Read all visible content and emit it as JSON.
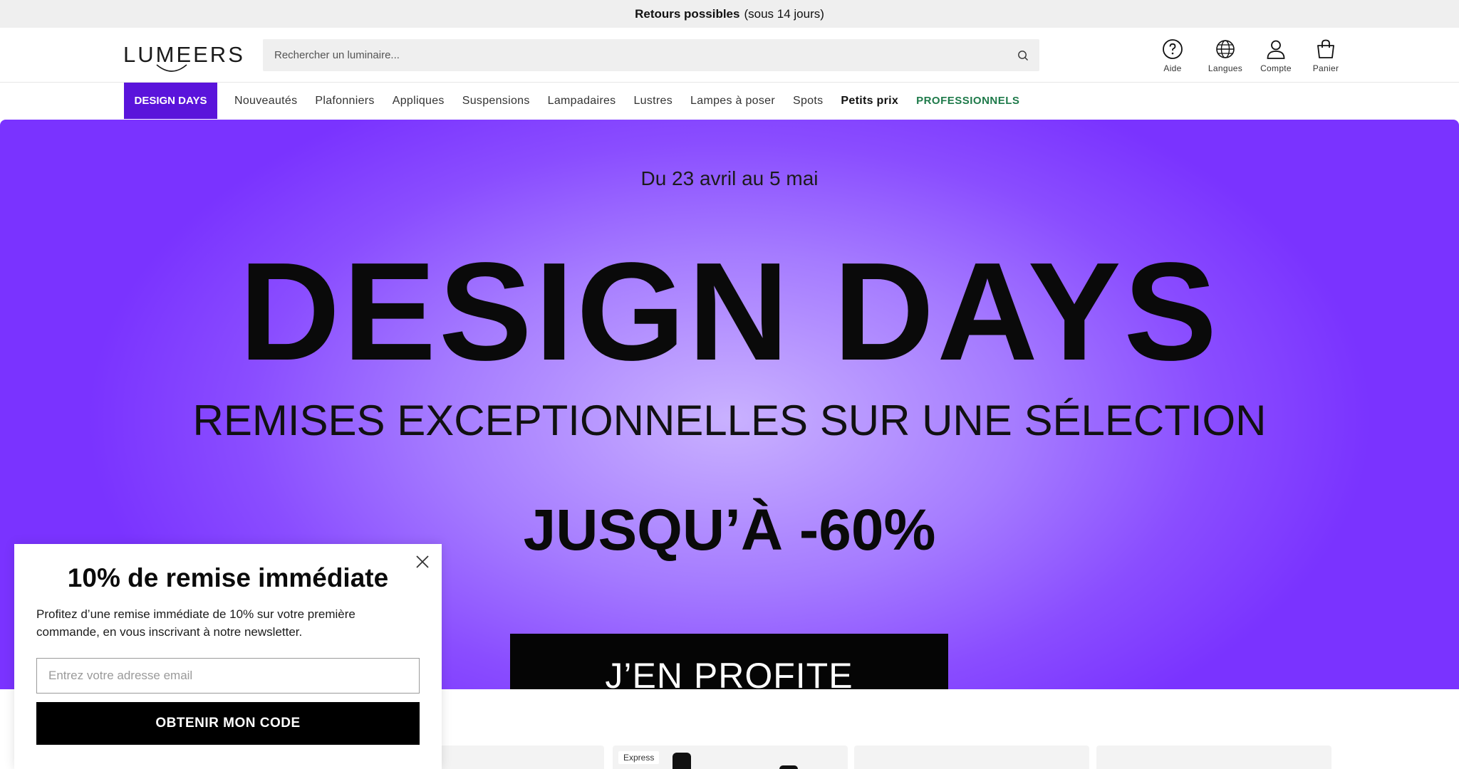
{
  "announcement": {
    "bold": "Retours possibles",
    "rest": "(sous 14 jours)"
  },
  "header": {
    "logo_text": "LUMEERS",
    "search_placeholder": "Rechercher un luminaire...",
    "icons": [
      {
        "label": "Aide",
        "icon": "help-circle-icon"
      },
      {
        "label": "Langues",
        "icon": "globe-icon"
      },
      {
        "label": "Compte",
        "icon": "user-icon"
      },
      {
        "label": "Panier",
        "icon": "shopping-bag-icon"
      }
    ]
  },
  "nav": {
    "primary": "DESIGN DAYS",
    "items": [
      "Nouveautés",
      "Plafonniers",
      "Appliques",
      "Suspensions",
      "Lampadaires",
      "Lustres",
      "Lampes à poser",
      "Spots",
      "Petits prix",
      "PROFESSIONNELS"
    ],
    "primary_color": "#5a14db",
    "pro_color": "#1e7a4a"
  },
  "hero": {
    "date": "Du 23 avril au 5 mai",
    "title": "DESIGN DAYS",
    "subtitle": "REMISES EXCEPTIONNELLES SUR UNE SÉLECTION",
    "discount": "JUSQU’À -60%",
    "cta": "J’EN PROFITE",
    "bg_color": "#8a4dff"
  },
  "cards": {
    "badge": "Express"
  },
  "popup": {
    "title": "10% de remise immédiate",
    "text": "Profitez d’une remise immédiate de 10% sur votre première commande, en vous inscrivant à notre newsletter.",
    "email_placeholder": "Entrez votre adresse email",
    "button": "OBTENIR MON CODE"
  }
}
